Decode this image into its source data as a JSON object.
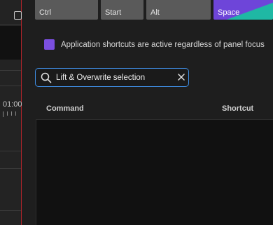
{
  "timeline": {
    "timecode": "01:00"
  },
  "keys": {
    "ctrl": "Ctrl",
    "start": "Start",
    "alt": "Alt",
    "space": "Space"
  },
  "shortcuts_option": {
    "label": "Application shortcuts are active regardless of panel focus",
    "checked": true
  },
  "search": {
    "value": "Lift & Overwrite selection"
  },
  "table": {
    "columns": [
      "Command",
      "Shortcut"
    ],
    "rows": []
  },
  "colors": {
    "accent_purple": "#7b4fe0",
    "focus_blue": "#3f8fe6",
    "playhead_red": "#b4242b",
    "space_teal": "#1fb8a4"
  }
}
